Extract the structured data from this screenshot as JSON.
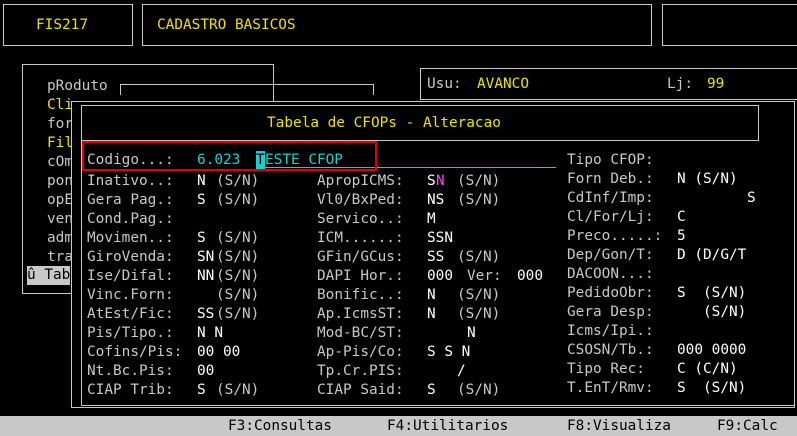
{
  "header": {
    "code": "FIS217",
    "title": "CADASTRO BASICOS"
  },
  "session": {
    "user_label": "Usu:",
    "user_value": "AVANCO",
    "store_label": "Lj:",
    "store_value": "99"
  },
  "menu": {
    "items": [
      "pRoduto",
      "Cli",
      "for",
      "Fil",
      "cOm",
      "pon",
      "opE",
      "ven",
      "adm",
      "tra",
      "û Tab"
    ]
  },
  "dialog": {
    "title": "Tabela de CFOPs - Alteracao",
    "codigo": {
      "label": "Codigo...:",
      "code": "6.023",
      "desc_first": "T",
      "desc_rest": "ESTE CFOP"
    },
    "col1": [
      {
        "label": "Inativo..:",
        "value": "N",
        "hint": "(S/N)"
      },
      {
        "label": "Gera Pag.:",
        "value": "S",
        "hint": "(S/N)"
      },
      {
        "label": "Cond.Pag.:",
        "value": "",
        "hint": ""
      },
      {
        "label": "Movimen..:",
        "value": "S",
        "hint": "(S/N)"
      },
      {
        "label": "GiroVenda:",
        "value": "SN",
        "hint": "(S/N)"
      },
      {
        "label": "Ise/Difal:",
        "value": "NN",
        "hint": "(S/N)"
      },
      {
        "label": "Vinc.Forn:",
        "value": "",
        "hint": "(S/N)"
      },
      {
        "label": "AtEst/Fic:",
        "value": "SS",
        "hint": "(S/N)"
      },
      {
        "label": "Pis/Tipo.:",
        "value": "N N",
        "hint": ""
      },
      {
        "label": "Cofins/Pis:",
        "value": "00 00",
        "hint": ""
      },
      {
        "label": "Nt.Bc.Pis:",
        "value": "00",
        "hint": ""
      },
      {
        "label": "CIAP Trib:",
        "value": "S",
        "hint": "(S/N)"
      }
    ],
    "col2": [
      {
        "label": "ApropICMS:",
        "value": "S",
        "value2": "N",
        "hint": "(S/N)"
      },
      {
        "label": "Vl0/BxPed:",
        "value": "NS",
        "hint": "(S/N)"
      },
      {
        "label": "Servico..:",
        "value": "M",
        "hint": ""
      },
      {
        "label": "ICM......:",
        "value": "SSN",
        "hint": ""
      },
      {
        "label": "GFin/GCus:",
        "value": "SS",
        "hint": "(S/N)"
      },
      {
        "label": "DAPI Hor.:",
        "value": "000",
        "hint": "Ver:",
        "extra": "000"
      },
      {
        "label": "Bonific..:",
        "value": "N",
        "hint": "(S/N)"
      },
      {
        "label": "Ap.IcmsST:",
        "value": "N",
        "hint": "(S/N)"
      },
      {
        "label": "Mod-BC/ST:",
        "value": "N",
        "hint": ""
      },
      {
        "label": "Ap-Pis/Co:",
        "value": "S S N",
        "hint": ""
      },
      {
        "label": "Tp.Cr.PIS:",
        "value": "/",
        "hint": ""
      },
      {
        "label": "CIAP Said:",
        "value": "S",
        "hint": "(S/N)"
      }
    ],
    "col3": [
      {
        "label": "Tipo CFOP:",
        "value": ""
      },
      {
        "label": "Forn Deb.:",
        "value": "N (S/N)"
      },
      {
        "label": "CdInf/Imp:",
        "value": "S"
      },
      {
        "label": "Cl/For/Lj:",
        "value": "C"
      },
      {
        "label": "Preco.....:",
        "value": "5"
      },
      {
        "label": "Dep/Gon/T:",
        "value": "D (D/G/T"
      },
      {
        "label": "DACOON...:",
        "value": ""
      },
      {
        "label": "PedidoObr:",
        "value": "S  (S/N)"
      },
      {
        "label": "Gera Desp:",
        "value": "   (S/N)"
      },
      {
        "label": "Icms/Ipi.:",
        "value": ""
      },
      {
        "label": "CSOSN/Tb.:",
        "value": "000 0000"
      },
      {
        "label": "Tipo Rec:",
        "value": "C (C/N)"
      },
      {
        "label": "T.EnT/Rmv:",
        "value": "S  (S/N)"
      }
    ]
  },
  "fkeys": [
    "F3:Consultas",
    "F4:Utilitarios",
    "F8:Visualiza",
    "F9:Calc"
  ]
}
